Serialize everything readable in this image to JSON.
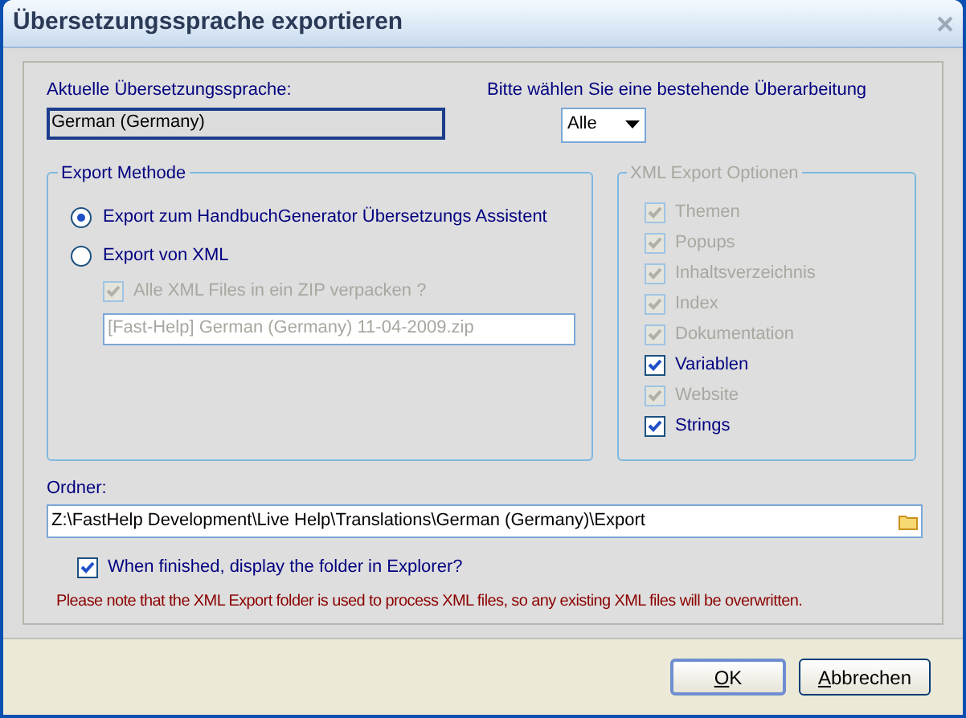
{
  "window": {
    "title": "Übersetzungssprache exportieren"
  },
  "current_language": {
    "label": "Aktuelle Übersetzungssprache:",
    "value": "German (Germany)"
  },
  "revision": {
    "label": "Bitte wählen Sie eine bestehende Überarbeitung",
    "value": "Alle"
  },
  "export_method": {
    "title": "Export Methode",
    "options": [
      {
        "label": "Export zum HandbuchGenerator Übersetzungs Assistent",
        "selected": true
      },
      {
        "label": "Export von XML",
        "selected": false
      }
    ],
    "zip": {
      "label": "Alle XML Files in ein ZIP verpacken ?",
      "checked": true,
      "disabled": true
    },
    "zip_name": {
      "value": "[Fast-Help] German (Germany) 11-04-2009.zip",
      "disabled": true
    }
  },
  "xml_options": {
    "title": "XML Export Optionen",
    "disabled": true,
    "items": [
      {
        "label": "Themen",
        "checked": true,
        "disabled": true
      },
      {
        "label": "Popups",
        "checked": true,
        "disabled": true
      },
      {
        "label": "Inhaltsverzeichnis",
        "checked": true,
        "disabled": true
      },
      {
        "label": "Index",
        "checked": true,
        "disabled": true
      },
      {
        "label": "Dokumentation",
        "checked": true,
        "disabled": true
      },
      {
        "label": "Variablen",
        "checked": true,
        "disabled": false
      },
      {
        "label": "Website",
        "checked": true,
        "disabled": true
      },
      {
        "label": "Strings",
        "checked": true,
        "disabled": false
      }
    ]
  },
  "folder": {
    "label": "Ordner:",
    "value": "Z:\\FastHelp Development\\Live Help\\Translations\\German (Germany)\\Export"
  },
  "show_folder": {
    "label": "When finished, display the folder in Explorer?",
    "checked": true,
    "disabled": false
  },
  "note": "Please note that the XML Export folder is used to process XML files, so any existing XML files will be overwritten.",
  "buttons": [
    {
      "label": "OK",
      "default": true
    },
    {
      "label": "Abbrechen",
      "default": false
    }
  ]
}
